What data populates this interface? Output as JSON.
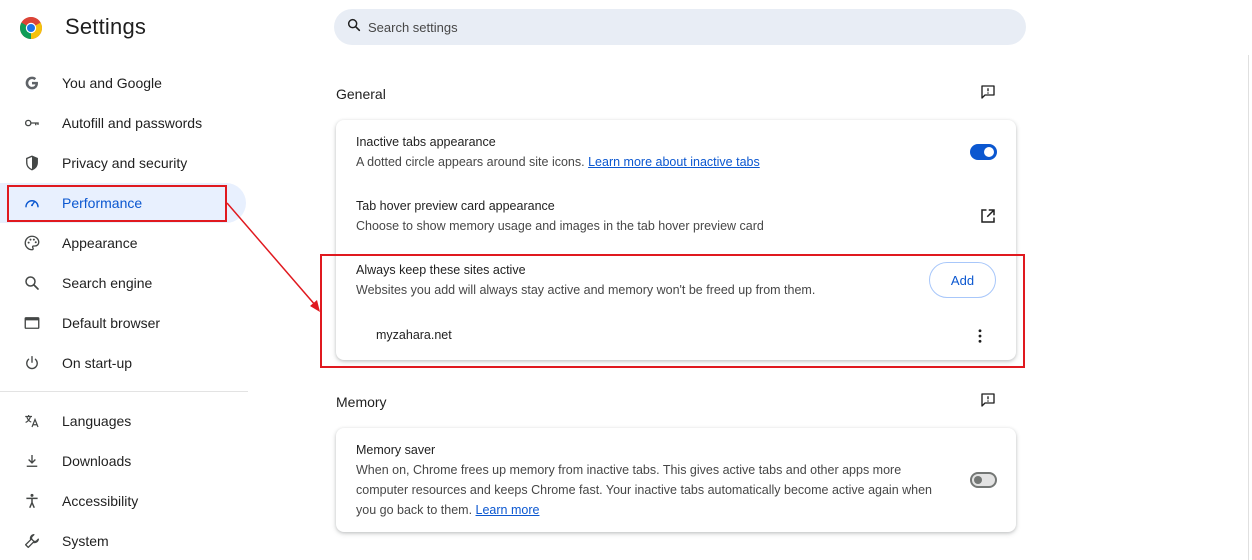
{
  "header": {
    "title": "Settings",
    "search_placeholder": "Search settings"
  },
  "sidebar": {
    "items": [
      {
        "label": "You and Google",
        "icon": "google-g-icon"
      },
      {
        "label": "Autofill and passwords",
        "icon": "key-icon"
      },
      {
        "label": "Privacy and security",
        "icon": "shield-icon"
      },
      {
        "label": "Performance",
        "icon": "gauge-icon",
        "active": true
      },
      {
        "label": "Appearance",
        "icon": "palette-icon"
      },
      {
        "label": "Search engine",
        "icon": "search-icon"
      },
      {
        "label": "Default browser",
        "icon": "browser-window-icon"
      },
      {
        "label": "On start-up",
        "icon": "power-icon"
      }
    ],
    "advanced_items": [
      {
        "label": "Languages",
        "icon": "translate-icon"
      },
      {
        "label": "Downloads",
        "icon": "download-icon"
      },
      {
        "label": "Accessibility",
        "icon": "accessibility-icon"
      },
      {
        "label": "System",
        "icon": "wrench-icon"
      }
    ]
  },
  "general": {
    "title": "General",
    "inactive_tabs": {
      "title": "Inactive tabs appearance",
      "desc": "A dotted circle appears around site icons.",
      "link": "Learn more about inactive tabs",
      "toggle_on": true
    },
    "hover_preview": {
      "title": "Tab hover preview card appearance",
      "desc": "Choose to show memory usage and images in the tab hover preview card"
    },
    "keep_active": {
      "title": "Always keep these sites active",
      "desc": "Websites you add will always stay active and memory won't be freed up from them.",
      "add_label": "Add",
      "sites": [
        "myzahara.net"
      ]
    }
  },
  "memory": {
    "title": "Memory",
    "memory_saver": {
      "title": "Memory saver",
      "desc_line1": "When on, Chrome frees up memory from inactive tabs. This gives active tabs and other apps more",
      "desc_line2": "computer resources and keeps Chrome fast. Your inactive tabs automatically become active again when",
      "desc_line3": "you go back to them.",
      "link": "Learn more",
      "toggle_on": false
    }
  },
  "colors": {
    "accent": "#0b57d0",
    "active_bg": "#e8f0fe",
    "highlight": "#e0191f"
  }
}
